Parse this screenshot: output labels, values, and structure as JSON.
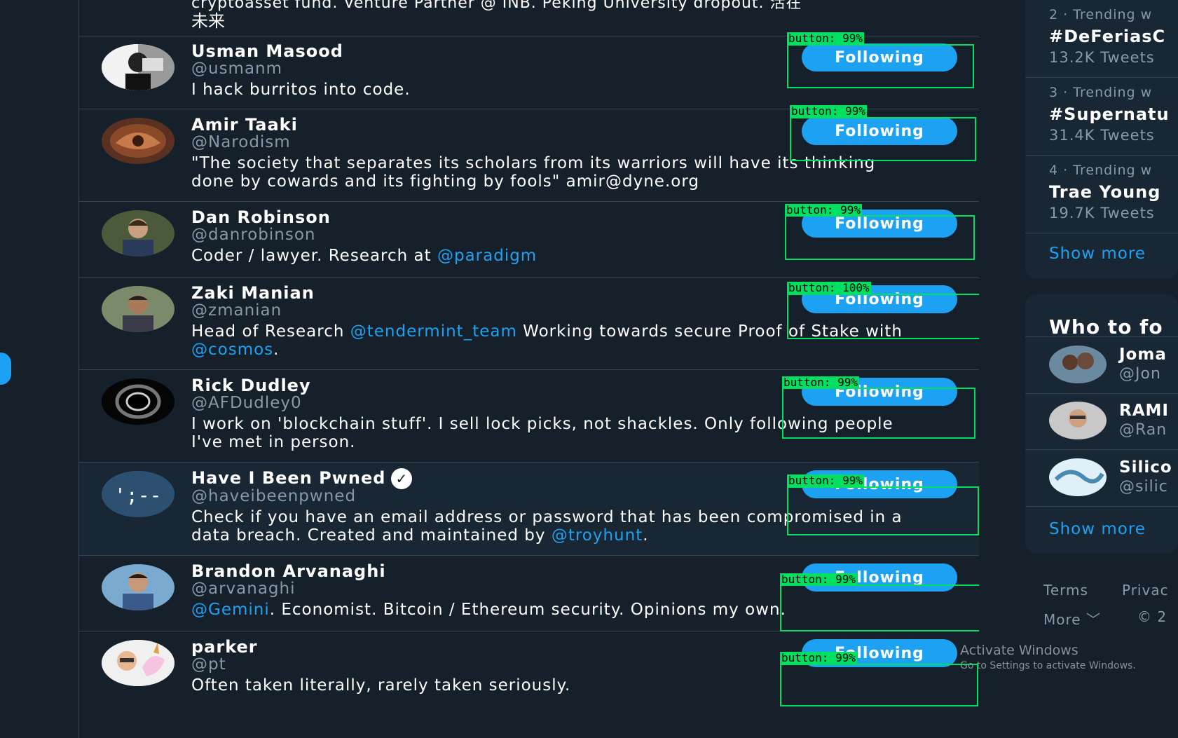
{
  "top_fragment": {
    "line1": "cryptoasset fund. Venture Partner @ INB. Peking University dropout. 活在",
    "line2": "未来"
  },
  "people": [
    {
      "name": "Usman Masood",
      "handle": "@usmanm",
      "bio": [
        {
          "t": "I hack burritos into code."
        }
      ],
      "button": "Following",
      "detection": "button: 99%"
    },
    {
      "name": "Amir Taaki",
      "handle": "@Narodism",
      "bio": [
        {
          "t": "\"The society that separates its scholars from its warriors will have its thinking done by cowards and its fighting by fools\" amir@dyne.org"
        }
      ],
      "button": "Following",
      "detection": "button: 99%"
    },
    {
      "name": "Dan Robinson",
      "handle": "@danrobinson",
      "bio": [
        {
          "t": "Coder / lawyer. Research at "
        },
        {
          "t": "@paradigm",
          "m": true
        }
      ],
      "button": "Following",
      "detection": "button: 99%"
    },
    {
      "name": "Zaki Manian",
      "handle": "@zmanian",
      "bio": [
        {
          "t": "Head of Research "
        },
        {
          "t": "@tendermint_team",
          "m": true
        },
        {
          "t": " Working towards secure Proof of Stake with "
        },
        {
          "t": "@cosmos",
          "m": true
        },
        {
          "t": "."
        }
      ],
      "button": "Following",
      "detection": "button: 100%"
    },
    {
      "name": "Rick Dudley",
      "handle": "@AFDudley0",
      "bio": [
        {
          "t": "I work on 'blockchain stuff'. I sell lock picks, not shackles. Only following people I've met in person."
        }
      ],
      "button": "Following",
      "detection": "button: 99%"
    },
    {
      "name": "Have I Been Pwned",
      "handle": "@haveibeenpwned",
      "verified": true,
      "bio": [
        {
          "t": "Check if you have an email address or password that has been compromised in a data breach. Created and maintained by "
        },
        {
          "t": "@troyhunt",
          "m": true
        },
        {
          "t": "."
        }
      ],
      "button": "Following",
      "detection": "button: 99%"
    },
    {
      "name": "Brandon Arvanaghi",
      "handle": "@arvanaghi",
      "bio": [
        {
          "t": "@Gemini",
          "m": true
        },
        {
          "t": ". Economist. Bitcoin / Ethereum security. Opinions my own."
        }
      ],
      "button": "Following",
      "detection": "button: 99%"
    },
    {
      "name": "parker",
      "handle": "@pt",
      "bio": [
        {
          "t": "Often taken literally, rarely taken seriously."
        }
      ],
      "button": "Following",
      "detection": "button: 99%"
    }
  ],
  "trends": [
    {
      "meta": "2 · Trending w",
      "tag": "#DeFeriasC",
      "count": "13.2K Tweets"
    },
    {
      "meta": "3 · Trending w",
      "tag": "#Supernatu",
      "count": "31.4K Tweets"
    },
    {
      "meta": "4 · Trending w",
      "tag": "Trae Young",
      "count": "19.7K Tweets"
    }
  ],
  "trends_show_more": "Show more",
  "who_to_follow": {
    "title": "Who to fo",
    "items": [
      {
        "name": "Joma",
        "handle": "@Jon"
      },
      {
        "name": "RAMI",
        "handle": "@Ran"
      },
      {
        "name": "Silico",
        "handle": "@silic"
      }
    ],
    "show_more": "Show more"
  },
  "footer": {
    "terms": "Terms",
    "privacy": "Privac",
    "more": "More",
    "more_chevron": "﹀",
    "copyright": "© 2"
  },
  "watermark": {
    "title": "Activate Windows",
    "subtitle": "Go to Settings to activate Windows."
  },
  "colors": {
    "accent": "#1da1f2",
    "background": "#15202b",
    "panel": "#192734",
    "detection": "#00e060"
  }
}
